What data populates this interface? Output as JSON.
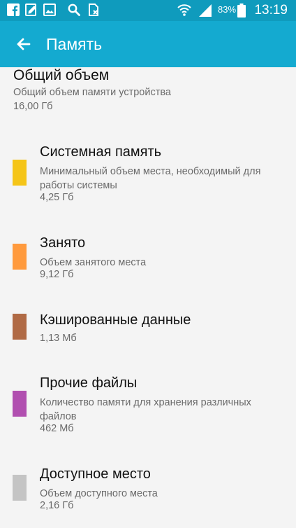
{
  "status_bar": {
    "icons": [
      "facebook-icon",
      "edit-note-icon",
      "image-icon",
      "search-icon",
      "sim-card-icon",
      "wifi-icon",
      "signal-icon",
      "battery-icon"
    ],
    "battery": "83%",
    "time": "13:19"
  },
  "header": {
    "title": "Память"
  },
  "total": {
    "title": "Общий объем",
    "description": "Общий объем памяти устройства",
    "value": "16,00 Гб"
  },
  "items": [
    {
      "title": "Системная память",
      "description": "Минимальный объем места, необходимый для работы системы",
      "value": "4,25 Гб",
      "color": "#f5c518"
    },
    {
      "title": "Занято",
      "description": "Объем занятого места",
      "value": "9,12 Гб",
      "color": "#ff9a3d"
    },
    {
      "title": "Кэшированные данные",
      "description": "",
      "value": "1,13 Мб",
      "color": "#b06a45"
    },
    {
      "title": "Прочие файлы",
      "description": "Количество памяти для хранения различных файлов",
      "value": "462 Мб",
      "color": "#b14fb0"
    },
    {
      "title": "Доступное место",
      "description": "Объем доступного места",
      "value": "2,16 Гб",
      "color": "#c4c4c4"
    }
  ]
}
